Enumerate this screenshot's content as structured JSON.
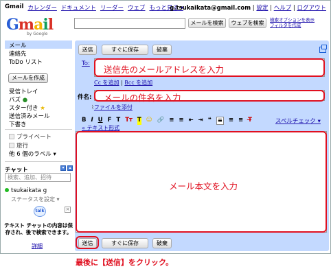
{
  "topnav": {
    "brand": "Gmail",
    "links": [
      "カレンダー",
      "ドキュメント",
      "リーダー",
      "ウェブ"
    ],
    "more": "もっと見る ▾"
  },
  "account": {
    "email": "g.tsukaikata@gmail.com",
    "links": [
      "設定",
      "ヘルプ",
      "ログアウト"
    ]
  },
  "logo": {
    "text": "Gmail",
    "sub": "by Google"
  },
  "search": {
    "mail_button": "メールを検索",
    "web_button": "ウェブを検索",
    "options": [
      "検索オプションを表示",
      "フィルタを作成"
    ]
  },
  "sidebar": {
    "items": [
      "メール",
      "連絡先",
      "ToDo リスト"
    ],
    "compose": "メールを作成",
    "folders": [
      "受信トレイ",
      "バズ",
      "スター付き",
      "送信済みメール",
      "下書き"
    ],
    "labels": [
      "プライベート",
      "旅行"
    ],
    "more_labels": "他 6 個のラベル ▾"
  },
  "chat": {
    "title": "チャット",
    "search_placeholder": "検索、追加、招待",
    "user": "tsukaikata g",
    "status": "ステータスを設定 ▾",
    "talk_icon": "talk",
    "note": "テキスト チャットの内容は保存され、後で検索できます。",
    "detail": "詳細"
  },
  "compose": {
    "send": "送信",
    "save": "すぐに保存",
    "discard": "破棄",
    "to_label": "To:",
    "cc": "Cc を追加",
    "separator": "|",
    "bcc": "Bcc を追加",
    "subject_label": "件名:",
    "attach": "ファイルを添付",
    "toolbar": [
      "B",
      "I",
      "U",
      "F",
      "T",
      "Tᴛ",
      "T",
      "☺",
      "🔗",
      "≡",
      "≡",
      "⇤",
      "⇥",
      "❝",
      "≡",
      "≡",
      "≡",
      "T̶"
    ],
    "spellcheck": "スペルチェック ▾",
    "richtext": "« テキスト形式"
  },
  "annotations": {
    "to": "送信先のメールアドレスを入力",
    "subject": "メールの件名を入力",
    "body": "メール本文を入力",
    "caption": "最後に【送信】をクリック。"
  },
  "colors": {
    "panel": "#c3d9ff",
    "annotation": "#e01020",
    "link": "#1a0dab"
  }
}
